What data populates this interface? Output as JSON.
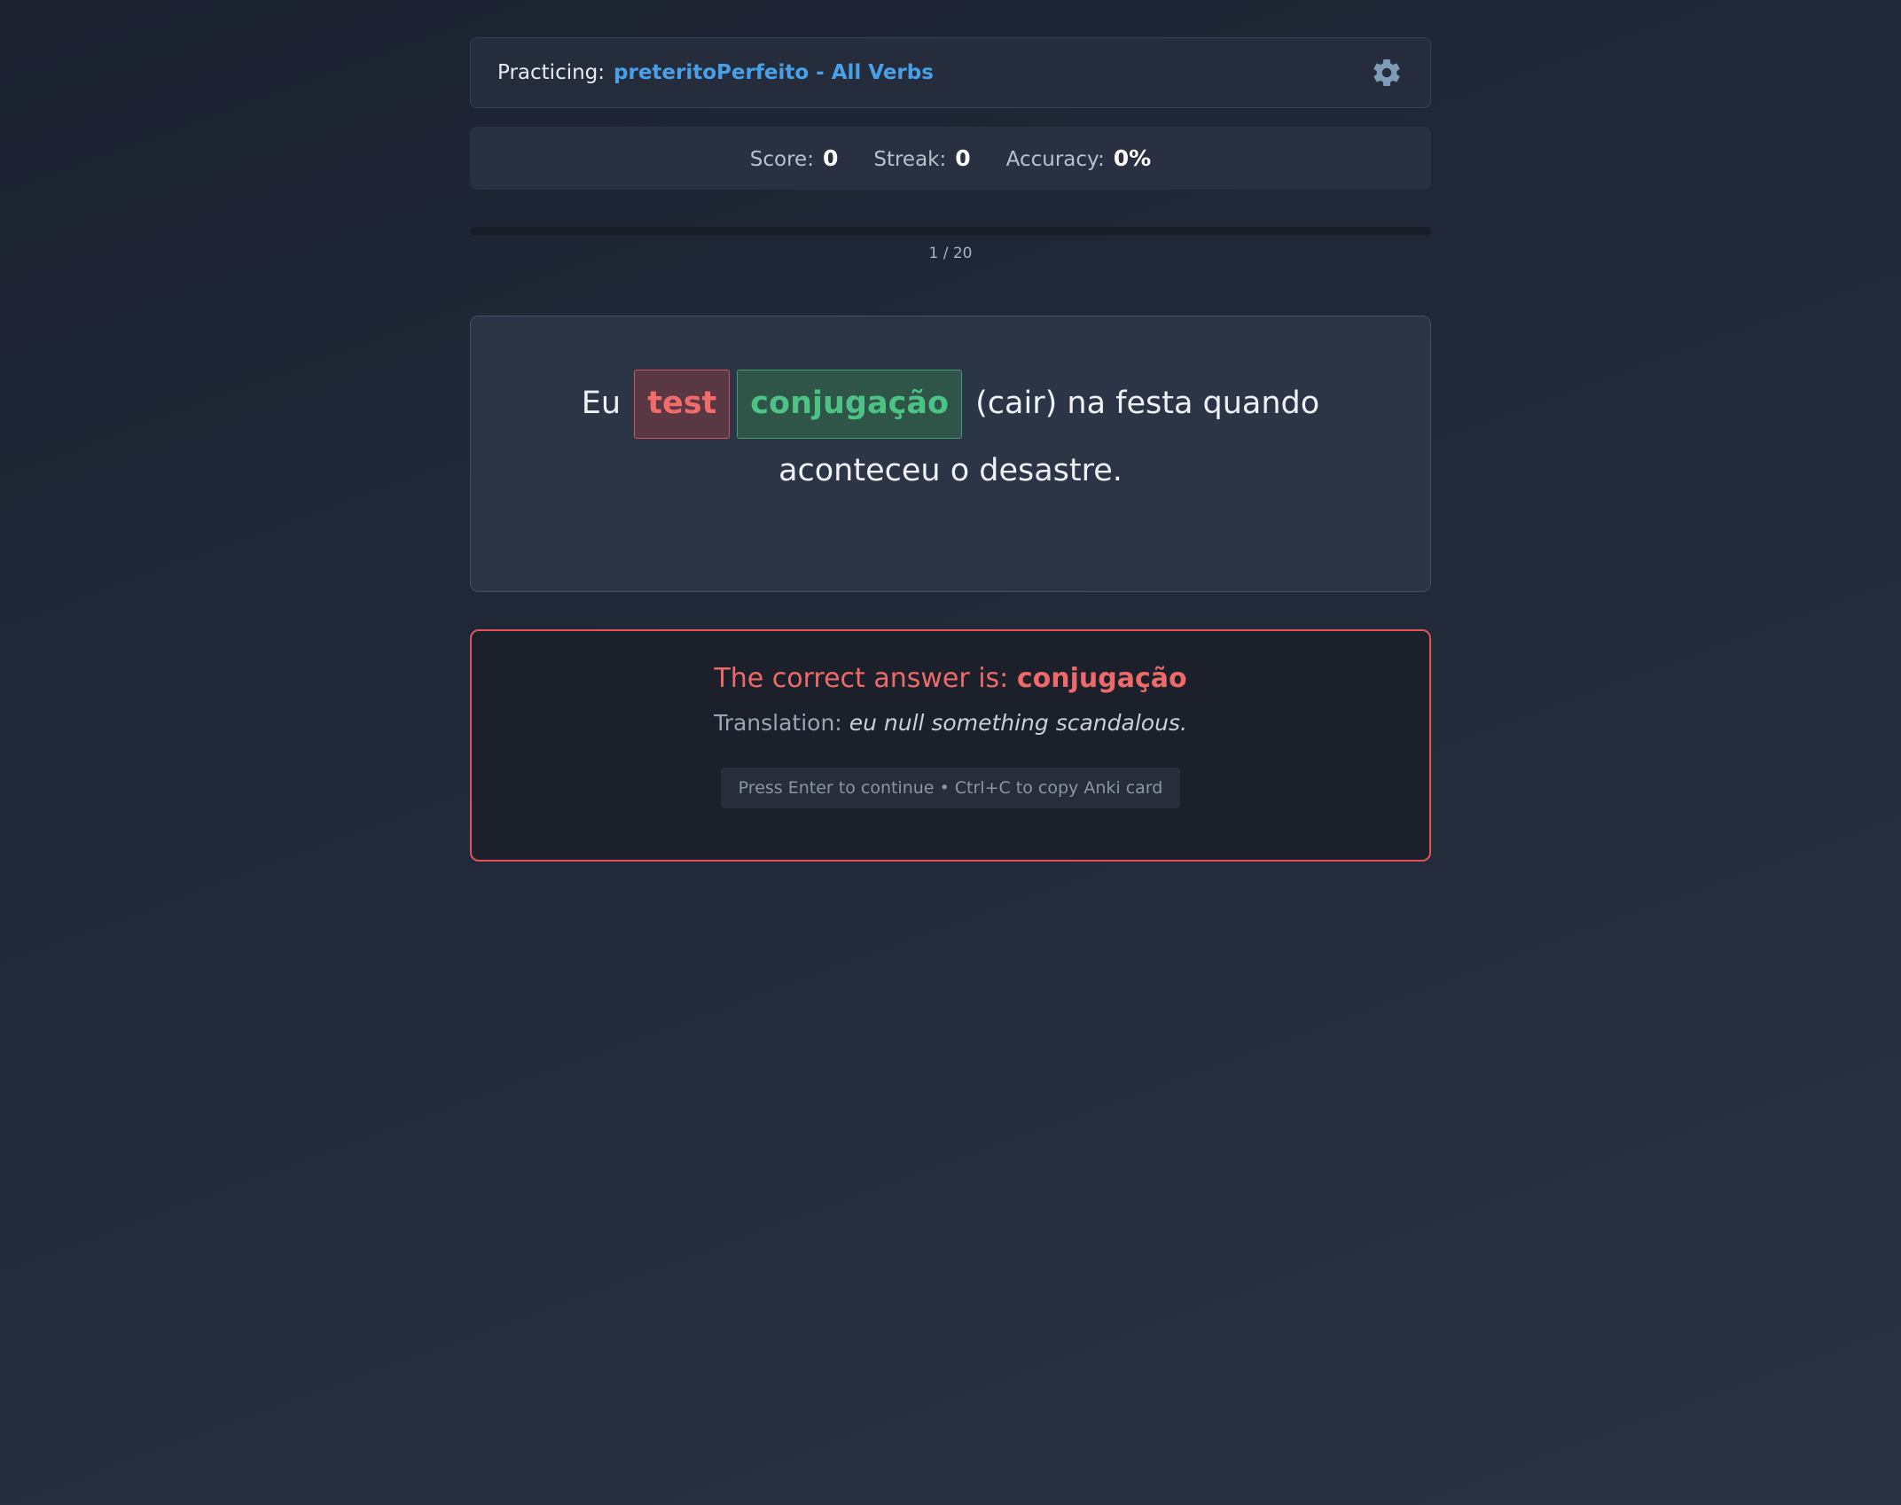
{
  "header": {
    "practicing_label": "Practicing:",
    "practicing_value": "preteritoPerfeito - All Verbs",
    "settings_icon": "gear-icon"
  },
  "stats": {
    "score_label": "Score:",
    "score_value": "0",
    "streak_label": "Streak:",
    "streak_value": "0",
    "accuracy_label": "Accuracy:",
    "accuracy_value": "0%"
  },
  "progress": {
    "text": "1 / 20",
    "current": 1,
    "total": 20,
    "fraction": 0
  },
  "question": {
    "prefix": "Eu",
    "user_answer": "test",
    "correct_answer": "conjugação",
    "suffix": "(cair) na festa quando aconteceu o desastre."
  },
  "feedback": {
    "answer_label": "The correct answer is:",
    "answer_value": "conjugação",
    "translation_label": "Translation:",
    "translation_value": "eu null something scandalous.",
    "hint": "Press Enter to continue • Ctrl+C to copy Anki card"
  },
  "colors": {
    "accent": "#4aa0e6",
    "wrong": "#f26b6b",
    "correct": "#4cc385",
    "feedback_border": "#e0535c"
  }
}
